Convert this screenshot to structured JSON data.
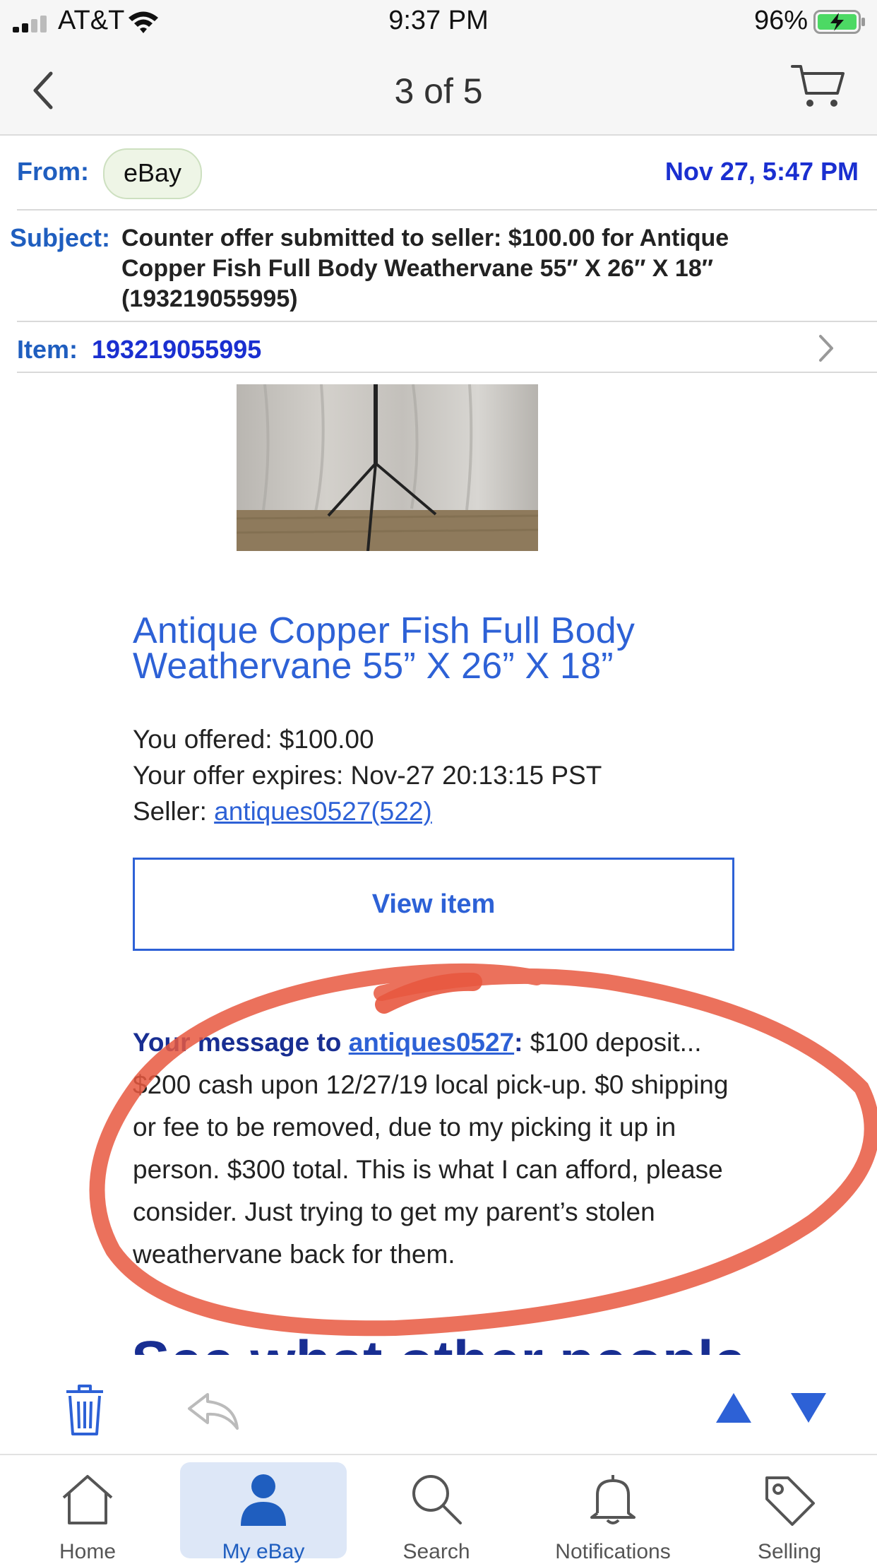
{
  "status_bar": {
    "carrier": "AT&T",
    "time": "9:37 PM",
    "battery": "96%"
  },
  "nav": {
    "title": "3 of 5"
  },
  "email": {
    "from_label": "From:",
    "from_value": "eBay",
    "date": "Nov 27, 5:47 PM",
    "subject_label": "Subject:",
    "subject": "Counter offer submitted to seller: $100.00 for Antique Copper Fish Full Body Weathervane 55″ X 26″ X 18″ (193219055995)",
    "item_label": "Item:",
    "item_number": "193219055995"
  },
  "content": {
    "item_title": "Antique Copper Fish Full Body Weathervane 55” X 26” X 18”",
    "offered": "You offered: $100.00",
    "expires": "Your offer expires: Nov-27 20:13:15 PST",
    "seller_label": "Seller: ",
    "seller_link": "antiques0527(522)",
    "view_item": "View item",
    "message_prefix": "Your message to ",
    "message_link": "antiques0527",
    "message_colon": ":",
    "message_body": " $100 deposit... $200 cash upon 12/27/19 local pick-up. $0 shipping or fee to be removed, due to my picking it up in person. $300 total. This is what I can afford, please consider. Just trying to get my parent’s stolen weathervane back for them.",
    "see_what": "See what other people"
  },
  "tabs": [
    {
      "label": "Home",
      "icon": "home-icon"
    },
    {
      "label": "My eBay",
      "icon": "person-icon",
      "active": true
    },
    {
      "label": "Search",
      "icon": "search-icon"
    },
    {
      "label": "Notifications",
      "icon": "bell-icon"
    },
    {
      "label": "Selling",
      "icon": "tag-icon"
    }
  ],
  "colors": {
    "link_blue": "#2d61d6",
    "dark_blue": "#182e92",
    "annotation_red": "#e8583f",
    "active_tab_bg": "#dde7f7"
  }
}
